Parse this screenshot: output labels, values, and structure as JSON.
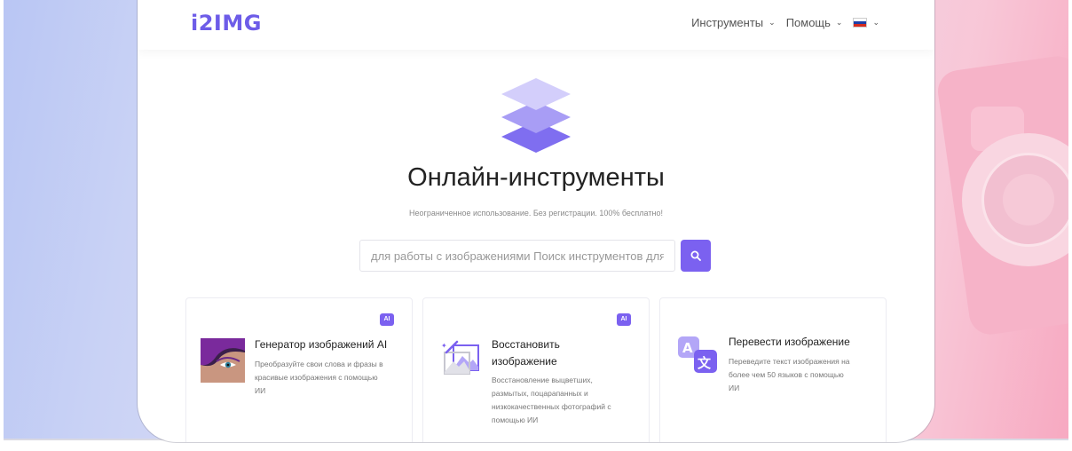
{
  "header": {
    "logo": "i2IMG",
    "nav": [
      {
        "label": "Инструменты",
        "icon": "chevron-down-icon"
      },
      {
        "label": "Помощь",
        "icon": "chevron-down-icon"
      }
    ],
    "language": {
      "icon": "russian-flag-icon",
      "dropdown_icon": "chevron-down-icon"
    }
  },
  "hero": {
    "icon": "layers-icon",
    "title": "Онлайн-инструменты",
    "subtitle": "Неограниченное использование. Без регистрации. 100% бесплатно!"
  },
  "search": {
    "placeholder": "для работы с изображениями Поиск инструментов для ра",
    "button_icon": "search-icon"
  },
  "tools": [
    {
      "badge": "AI",
      "icon": "portrait-image-icon",
      "title_lines": [
        "Генератор изображений AI"
      ],
      "desc_lines": [
        "Преобразуйте свои слова и фразы в",
        "красивые изображения с помощью",
        "ИИ"
      ]
    },
    {
      "badge": "AI",
      "icon": "magic-wand-image-icon",
      "title_lines": [
        "Восстановить",
        "изображение"
      ],
      "desc_lines": [
        "Восстановление выцветших,",
        "размытых, поцарапанных и",
        "низкокачественных фотографий с",
        "помощью ИИ"
      ]
    },
    {
      "icon": "translate-icon",
      "title_lines": [
        "Перевести изображение"
      ],
      "desc_lines": [
        "Переведите текст изображения на",
        "более чем 50 языков с помощью",
        "ИИ"
      ]
    }
  ],
  "colors": {
    "accent": "#7b61f0",
    "logo": "#6d5ce8"
  }
}
